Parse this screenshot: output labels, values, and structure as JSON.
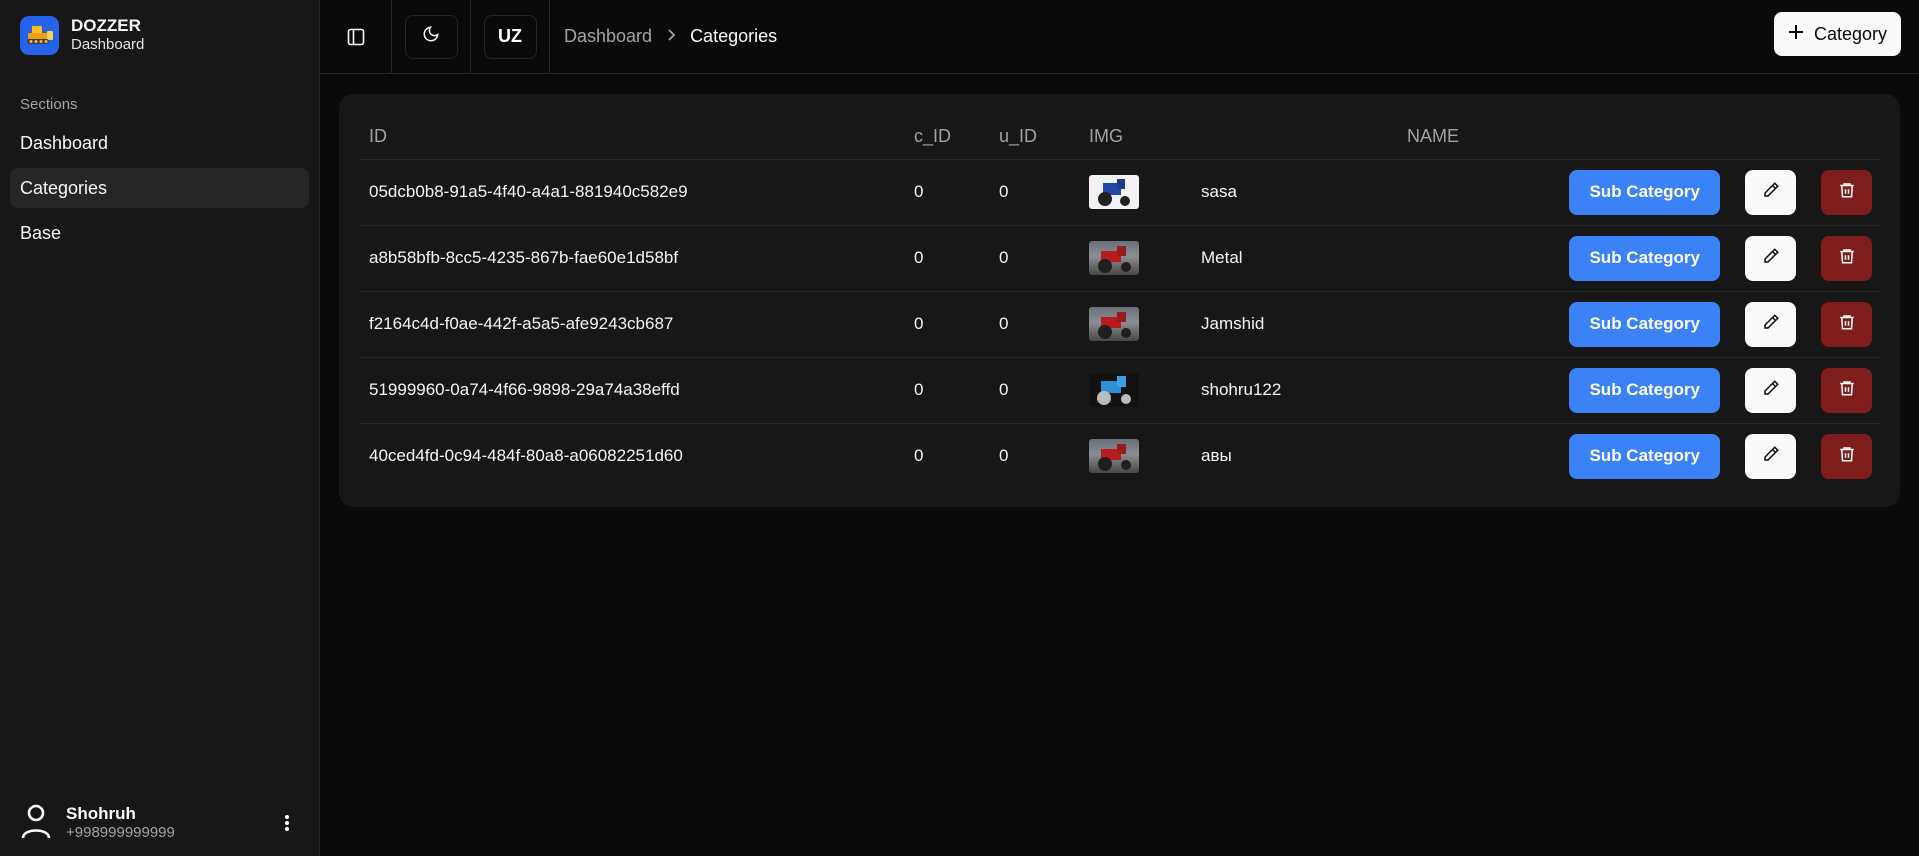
{
  "brand": {
    "name": "DOZZER",
    "subtitle": "Dashboard",
    "icon": "bulldozer-icon"
  },
  "sidebar": {
    "section_label": "Sections",
    "items": [
      {
        "label": "Dashboard",
        "active": false
      },
      {
        "label": "Categories",
        "active": true
      },
      {
        "label": "Base",
        "active": false
      }
    ]
  },
  "user": {
    "name": "Shohruh",
    "phone": "+998999999999"
  },
  "topbar": {
    "language": "UZ",
    "breadcrumb": {
      "parent": "Dashboard",
      "current": "Categories"
    },
    "add_button_label": "Category"
  },
  "table": {
    "headers": {
      "id": "ID",
      "c_id": "c_ID",
      "u_id": "u_ID",
      "img": "IMG",
      "name": "NAME"
    },
    "action_labels": {
      "sub_category": "Sub Category"
    },
    "rows": [
      {
        "id": "05dcb0b8-91a5-4f40-a4a1-881940c582e9",
        "c_id": "0",
        "u_id": "0",
        "img": "blue-tractor-white-bg",
        "name": "sasa"
      },
      {
        "id": "a8b58bfb-8cc5-4235-867b-fae60e1d58bf",
        "c_id": "0",
        "u_id": "0",
        "img": "red-tractor",
        "name": "Metal"
      },
      {
        "id": "f2164c4d-f0ae-442f-a5a5-afe9243cb687",
        "c_id": "0",
        "u_id": "0",
        "img": "red-tractor",
        "name": "Jamshid"
      },
      {
        "id": "51999960-0a74-4f66-9898-29a74a38effd",
        "c_id": "0",
        "u_id": "0",
        "img": "blue-tractor-dark-bg",
        "name": "shohru122"
      },
      {
        "id": "40ced4fd-0c94-484f-80a8-a06082251d60",
        "c_id": "0",
        "u_id": "0",
        "img": "red-tractor",
        "name": "авы"
      }
    ]
  },
  "colors": {
    "background": "#0a0a0a",
    "sidebar": "#171717",
    "card": "#171717",
    "accent_blue": "#3b82f6",
    "danger": "#7f1d1d",
    "logo_blue": "#2563eb"
  }
}
